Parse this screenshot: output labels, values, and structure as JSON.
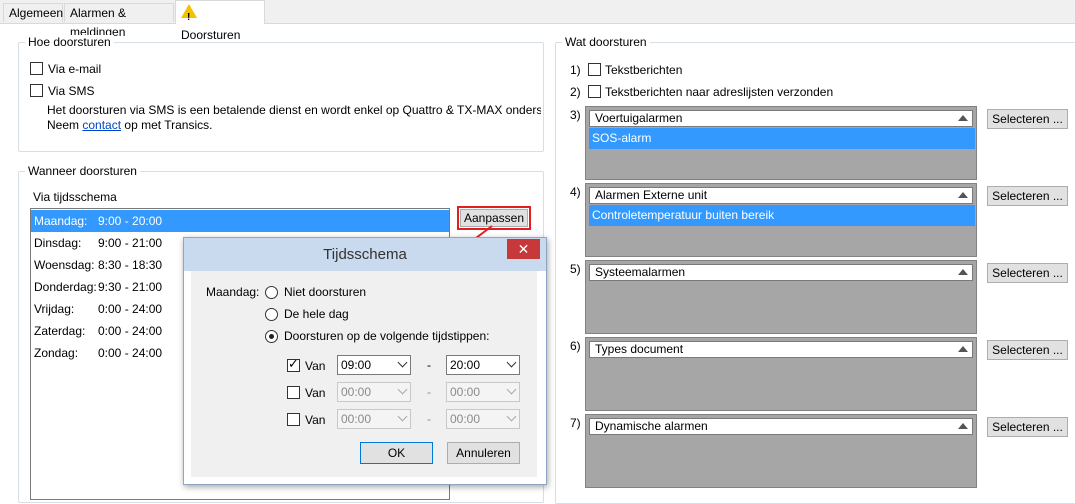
{
  "tabs": [
    {
      "label": "Algemeen"
    },
    {
      "label": "Alarmen & meldingen"
    },
    {
      "label": "Doorsturen"
    }
  ],
  "how": {
    "legend": "Hoe doorsturen",
    "email_label": "Via e-mail",
    "sms_label": "Via SMS",
    "note_line1": "Het doorsturen via SMS is een betalende dienst en wordt enkel op Quattro & TX-MAX ondersteund.",
    "note_pre": "Neem",
    "note_link": "contact",
    "note_post": "op met Transics."
  },
  "when": {
    "legend": "Wanneer doorsturen",
    "sublabel": "Via tijdsschema",
    "adjust_button": "Aanpassen",
    "schedule": [
      {
        "day": "Maandag:",
        "time": "9:00 - 20:00"
      },
      {
        "day": "Dinsdag:",
        "time": "9:00 - 21:00"
      },
      {
        "day": "Woensdag:",
        "time": "8:30 - 18:30"
      },
      {
        "day": "Donderdag:",
        "time": "9:30 - 21:00"
      },
      {
        "day": "Vrijdag:",
        "time": "0:00 - 24:00"
      },
      {
        "day": "Zaterdag:",
        "time": "0:00 - 24:00"
      },
      {
        "day": "Zondag:",
        "time": "0:00 - 24:00"
      }
    ]
  },
  "dialog": {
    "title": "Tijdsschema",
    "close": "✕",
    "day_label": "Maandag:",
    "opt_none": "Niet doorsturen",
    "opt_all_day": "De hele dag",
    "opt_times": "Doorsturen op de volgende tijdstippen:",
    "rows": [
      {
        "label": "Van",
        "from": "09:00",
        "sep": "-",
        "to": "20:00"
      },
      {
        "label": "Van",
        "from": "00:00",
        "sep": "-",
        "to": "00:00"
      },
      {
        "label": "Van",
        "from": "00:00",
        "sep": "-",
        "to": "00:00"
      }
    ],
    "ok": "OK",
    "cancel": "Annuleren"
  },
  "what": {
    "legend": "Wat doorsturen",
    "n1": "1)",
    "text_messages": "Tekstberichten",
    "n2": "2)",
    "text_messages_lists": "Tekstberichten naar adreslijsten verzonden",
    "select_label": "Selecteren ...",
    "groups": [
      {
        "num": "3)",
        "title": "Voertuigalarmen",
        "item": "SOS-alarm"
      },
      {
        "num": "4)",
        "title": "Alarmen Externe unit",
        "item": "Controletemperatuur buiten bereik"
      },
      {
        "num": "5)",
        "title": "Systeemalarmen",
        "item": ""
      },
      {
        "num": "6)",
        "title": "Types document",
        "item": ""
      },
      {
        "num": "7)",
        "title": "Dynamische alarmen",
        "item": ""
      }
    ]
  },
  "colors": {
    "selection": "#3399ff",
    "annotation": "#e02020"
  }
}
